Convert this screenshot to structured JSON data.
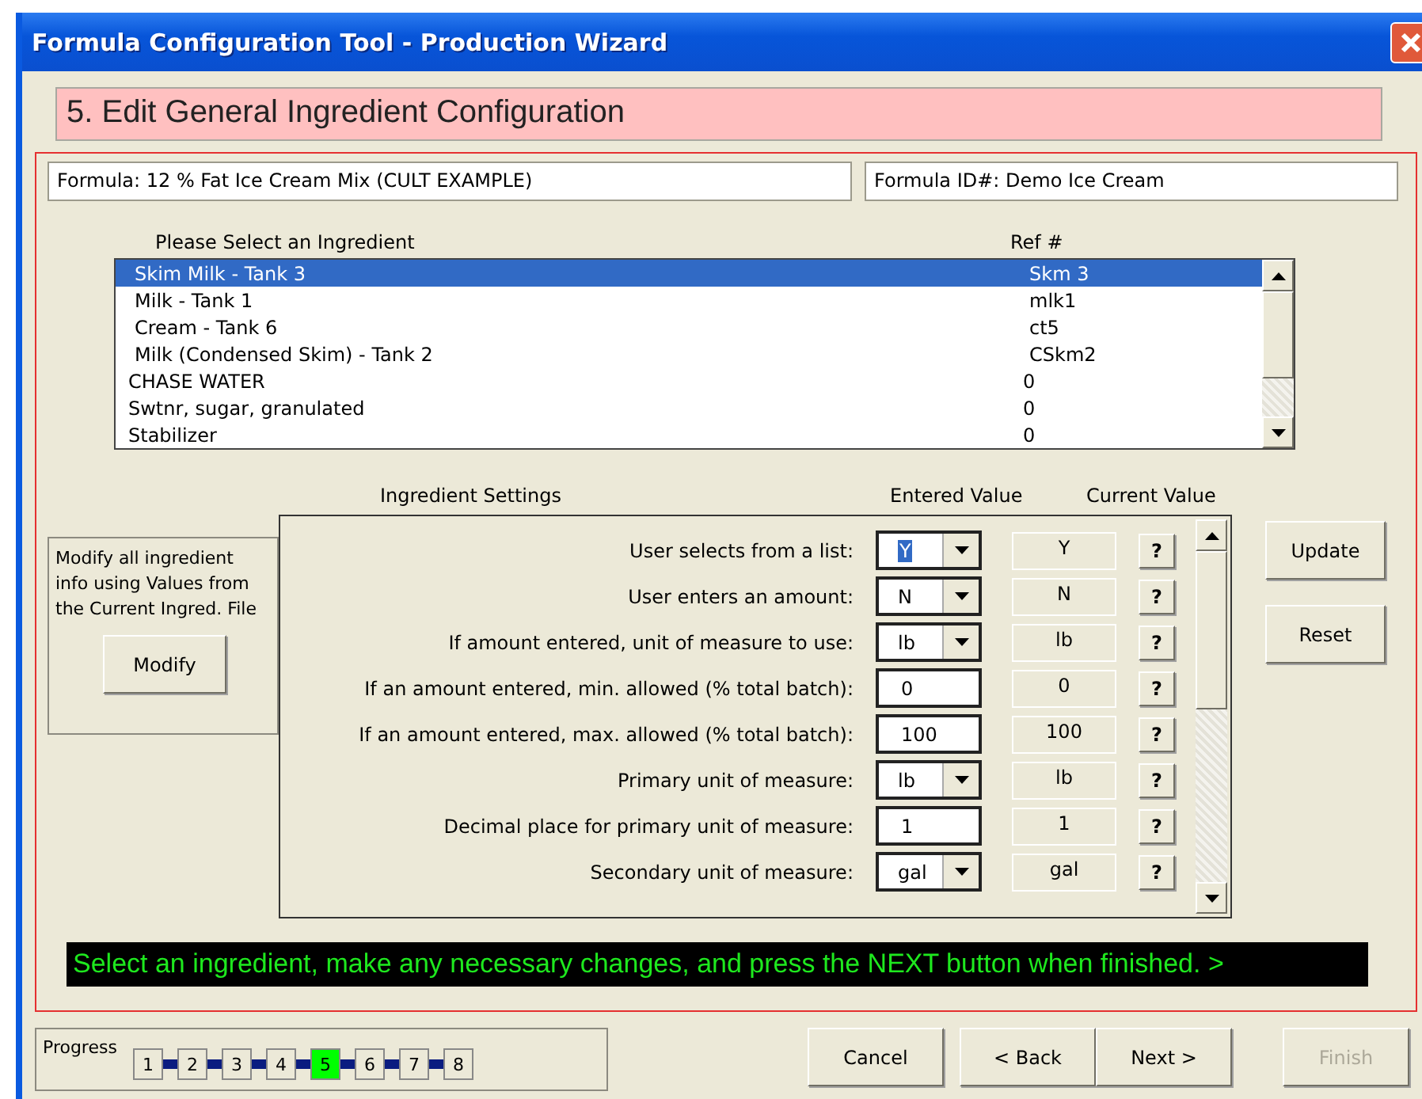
{
  "window": {
    "title": "Formula Configuration Tool - Production Wizard"
  },
  "step_title": "5. Edit General Ingredient Configuration",
  "formula": "Formula: 12 % Fat Ice Cream Mix (CULT EXAMPLE)",
  "formula_id": "Formula ID#: Demo Ice Cream",
  "ingredients": {
    "heading": "Please Select an Ingredient",
    "ref_heading": "Ref #",
    "rows": [
      {
        "name": "Skim Milk - Tank 3",
        "ref": "Skm 3",
        "selected": true
      },
      {
        "name": "Milk - Tank 1",
        "ref": "mlk1",
        "selected": false
      },
      {
        "name": "Cream - Tank 6",
        "ref": "ct5",
        "selected": false
      },
      {
        "name": "Milk (Condensed Skim) - Tank 2",
        "ref": "CSkm2",
        "selected": false
      },
      {
        "name": "CHASE WATER",
        "ref": "0",
        "selected": false
      },
      {
        "name": "Swtnr, sugar, granulated",
        "ref": "0",
        "selected": false
      },
      {
        "name": "Stabilizer",
        "ref": "0",
        "selected": false
      }
    ]
  },
  "modify": {
    "text": "Modify all ingredient info using Values from the Current Ingred. File",
    "button": "Modify"
  },
  "settings": {
    "heading": "Ingredient Settings",
    "entered_heading": "Entered Value",
    "current_heading": "Current Value",
    "rows": [
      {
        "label": "User selects from a list:",
        "kind": "dropdown",
        "value": "Y",
        "current": "Y",
        "help": "?",
        "focused": true
      },
      {
        "label": "User enters an amount:",
        "kind": "dropdown",
        "value": "N",
        "current": "N",
        "help": "?",
        "focused": false
      },
      {
        "label": "If amount entered, unit of measure to use:",
        "kind": "dropdown",
        "value": "lb",
        "current": "lb",
        "help": "?",
        "focused": false
      },
      {
        "label": "If an amount entered, min. allowed (% total batch):",
        "kind": "text",
        "value": "0",
        "current": "0",
        "help": "?",
        "focused": false
      },
      {
        "label": "If an amount entered, max. allowed (% total batch):",
        "kind": "text",
        "value": "100",
        "current": "100",
        "help": "?",
        "focused": false
      },
      {
        "label": "Primary unit of measure:",
        "kind": "dropdown",
        "value": "lb",
        "current": "lb",
        "help": "?",
        "focused": false
      },
      {
        "label": "Decimal place for primary unit of measure:",
        "kind": "text",
        "value": "1",
        "current": "1",
        "help": "?",
        "focused": false
      },
      {
        "label": "Secondary unit of measure:",
        "kind": "dropdown",
        "value": "gal",
        "current": "gal",
        "help": "?",
        "focused": false
      }
    ]
  },
  "side_buttons": [
    "Update",
    "Reset"
  ],
  "instruction": "Select an ingredient, make any necessary changes, and press the NEXT button when finished. >",
  "progress": {
    "label": "Progress",
    "steps": [
      {
        "label": "1",
        "selected": false
      },
      {
        "label": "2",
        "selected": false
      },
      {
        "label": "3",
        "selected": false
      },
      {
        "label": "4",
        "selected": false
      },
      {
        "label": "5",
        "selected": true
      },
      {
        "label": "6",
        "selected": false
      },
      {
        "label": "7",
        "selected": false
      },
      {
        "label": "8",
        "selected": false
      }
    ]
  },
  "buttons": [
    {
      "label": "Cancel",
      "disabled": false
    },
    {
      "label": "< Back",
      "disabled": false
    },
    {
      "label": "Next >",
      "disabled": false
    },
    {
      "label": "Finish",
      "disabled": true
    }
  ]
}
